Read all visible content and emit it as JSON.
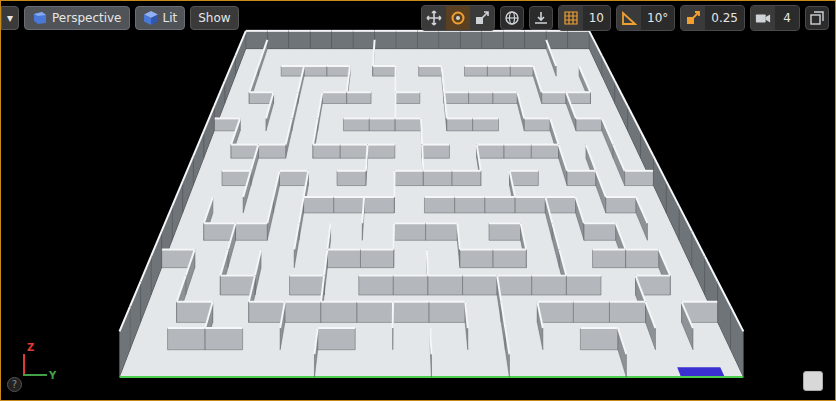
{
  "viewport_menu": {
    "label": "▾"
  },
  "view_buttons": [
    {
      "label": "Perspective",
      "kind": "perspective"
    },
    {
      "label": "Lit",
      "kind": "lit"
    },
    {
      "label": "Show",
      "kind": "plain"
    }
  ],
  "transform_tools": [
    {
      "kind": "translate",
      "selected": false
    },
    {
      "kind": "rotate",
      "selected": true
    },
    {
      "kind": "scale",
      "selected": false
    }
  ],
  "coordinate_space": {
    "kind": "world"
  },
  "surface_snapping": {
    "on": false
  },
  "snaps": [
    {
      "kind": "grid",
      "value": "10",
      "on": true
    },
    {
      "kind": "angle",
      "value": "10°",
      "on": true
    },
    {
      "kind": "scale",
      "value": "0.25",
      "on": true
    }
  ],
  "camera_speed": {
    "value": "4"
  },
  "axis_gizmo": [
    {
      "label": "Z",
      "color": "#e53935"
    },
    {
      "label": "Y",
      "color": "#43a047"
    }
  ],
  "help_button": {
    "label": "?"
  }
}
